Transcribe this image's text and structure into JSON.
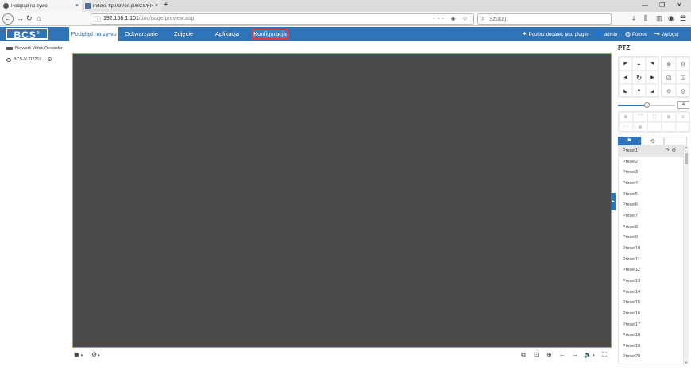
{
  "browser": {
    "tabs": [
      {
        "title": "Podgląd na żywo",
        "active": true
      },
      {
        "title": "Indeks ftp://chron.pl/BCS/FIR",
        "active": false
      }
    ],
    "url_host": "192.168.1.101",
    "url_path": "/doc/page/preview.asp",
    "search_placeholder": "Szukaj"
  },
  "app": {
    "logo": "BCS",
    "nav": {
      "live": "Podgląd na żywo",
      "playback": "Odtwarzanie",
      "picture": "Zdjęcie",
      "application": "Aplikacja",
      "config": "Konfiguracja"
    },
    "header_right": {
      "plugin": "Pobierz dodatek typu plug-in",
      "user": "admin",
      "help": "Pomoc",
      "logout": "Wyloguj"
    },
    "accent_color": "#2f73b8",
    "highlight_color": "#e53935"
  },
  "tree": {
    "root": "Network Video Recorder",
    "camera": "BCS-V-TI221I..."
  },
  "ptz": {
    "title": "PTZ",
    "speed_value": "4",
    "speed_fraction": 0.5,
    "presets": [
      "Preset1",
      "Preset2",
      "Preset3",
      "Preset4",
      "Preset5",
      "Preset6",
      "Preset7",
      "Preset8",
      "Preset9",
      "Preset10",
      "Preset11",
      "Preset12",
      "Preset13",
      "Preset14",
      "Preset15",
      "Preset16",
      "Preset17",
      "Preset18",
      "Preset19",
      "Preset20"
    ]
  }
}
